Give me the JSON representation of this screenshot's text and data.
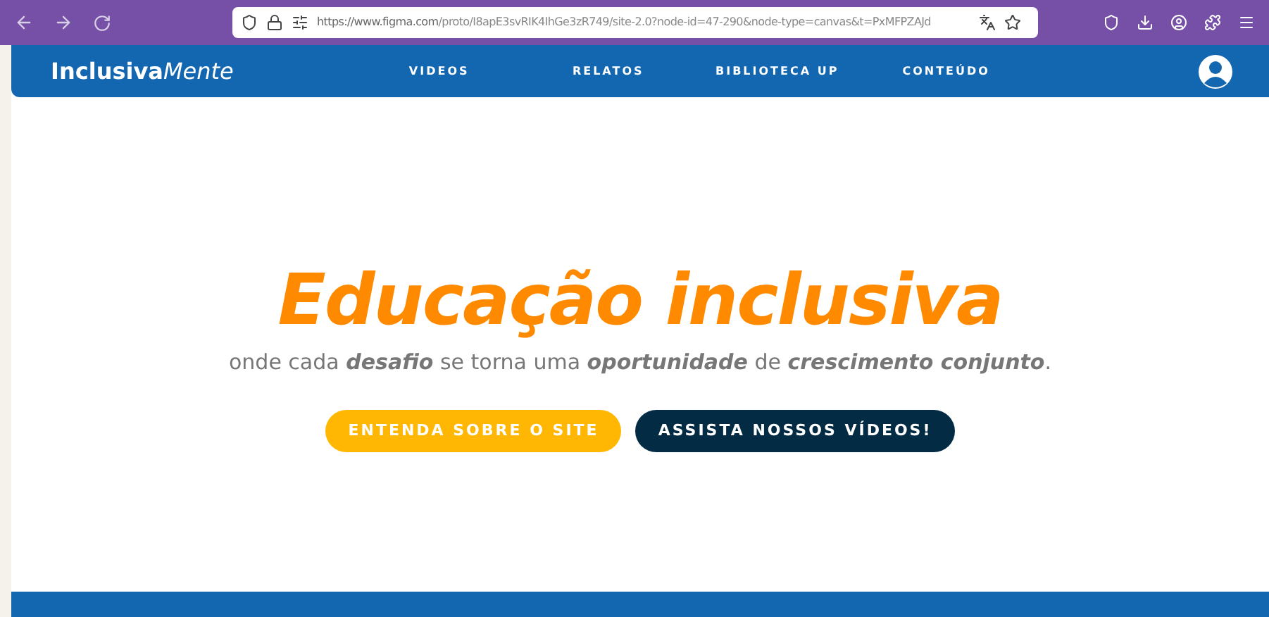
{
  "browser": {
    "url_host": "https://www.figma.com",
    "url_rest": "/proto/I8apE3svRIK4IhGe3zR749/site-2.0?node-id=47-290&node-type=canvas&t=PxMFPZAJd"
  },
  "navbar": {
    "logo": {
      "strong": "Inclusiva",
      "light": "Mente"
    },
    "items": [
      {
        "label": "VIDEOS"
      },
      {
        "label": "RELATOS"
      },
      {
        "label": "BIBLIOTECA UP"
      },
      {
        "label": "CONTEÚDO"
      }
    ]
  },
  "hero": {
    "title": "Educação inclusiva",
    "subtitle": "onde cada *desafio* se torna uma *oportunidade* de *crescimento conjunto*.",
    "buttons": [
      {
        "label": "ENTENDA SOBRE O SITE",
        "kind": "primary"
      },
      {
        "label": "ASSISTA NOSSOS VÍDEOS!",
        "kind": "secondary"
      }
    ]
  }
}
